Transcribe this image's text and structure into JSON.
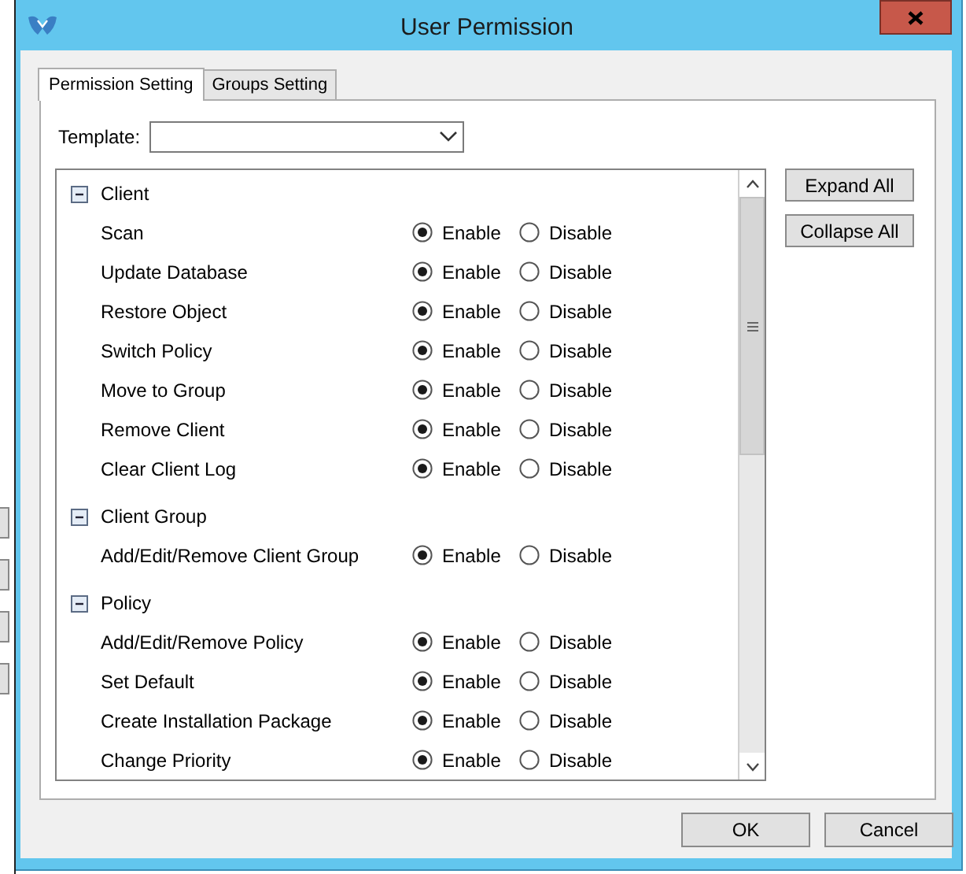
{
  "window": {
    "title": "User Permission"
  },
  "tabs": [
    {
      "label": "Permission Setting",
      "selected": true
    },
    {
      "label": "Groups Setting",
      "selected": false
    }
  ],
  "template": {
    "label": "Template:"
  },
  "groups": [
    {
      "name": "Client",
      "expanded": true,
      "items": [
        {
          "name": "Scan",
          "options": [
            {
              "label": "Enable",
              "selected": true
            },
            {
              "label": "Disable",
              "selected": false
            }
          ]
        },
        {
          "name": "Update Database",
          "options": [
            {
              "label": "Enable",
              "selected": true
            },
            {
              "label": "Disable",
              "selected": false
            }
          ]
        },
        {
          "name": "Restore Object",
          "options": [
            {
              "label": "Enable",
              "selected": true
            },
            {
              "label": "Disable",
              "selected": false
            }
          ]
        },
        {
          "name": "Switch Policy",
          "options": [
            {
              "label": "Enable",
              "selected": true
            },
            {
              "label": "Disable",
              "selected": false
            }
          ]
        },
        {
          "name": "Move to Group",
          "options": [
            {
              "label": "Enable",
              "selected": true
            },
            {
              "label": "Disable",
              "selected": false
            }
          ]
        },
        {
          "name": "Remove Client",
          "options": [
            {
              "label": "Enable",
              "selected": true
            },
            {
              "label": "Disable",
              "selected": false
            }
          ]
        },
        {
          "name": "Clear Client Log",
          "options": [
            {
              "label": "Enable",
              "selected": true
            },
            {
              "label": "Disable",
              "selected": false
            }
          ]
        }
      ]
    },
    {
      "name": "Client Group",
      "expanded": true,
      "items": [
        {
          "name": "Add/Edit/Remove Client Group",
          "options": [
            {
              "label": "Enable",
              "selected": true
            },
            {
              "label": "Disable",
              "selected": false
            }
          ]
        }
      ]
    },
    {
      "name": "Policy",
      "expanded": true,
      "items": [
        {
          "name": "Add/Edit/Remove Policy",
          "options": [
            {
              "label": "Enable",
              "selected": true
            },
            {
              "label": "Disable",
              "selected": false
            }
          ]
        },
        {
          "name": "Set Default",
          "options": [
            {
              "label": "Enable",
              "selected": true
            },
            {
              "label": "Disable",
              "selected": false
            }
          ]
        },
        {
          "name": "Create Installation Package",
          "options": [
            {
              "label": "Enable",
              "selected": true
            },
            {
              "label": "Disable",
              "selected": false
            }
          ]
        },
        {
          "name": "Change Priority",
          "options": [
            {
              "label": "Enable",
              "selected": true
            },
            {
              "label": "Disable",
              "selected": false
            }
          ]
        }
      ]
    }
  ],
  "side_buttons": [
    "Expand All",
    "Collapse All"
  ],
  "dialog_buttons": [
    "OK",
    "Cancel"
  ]
}
